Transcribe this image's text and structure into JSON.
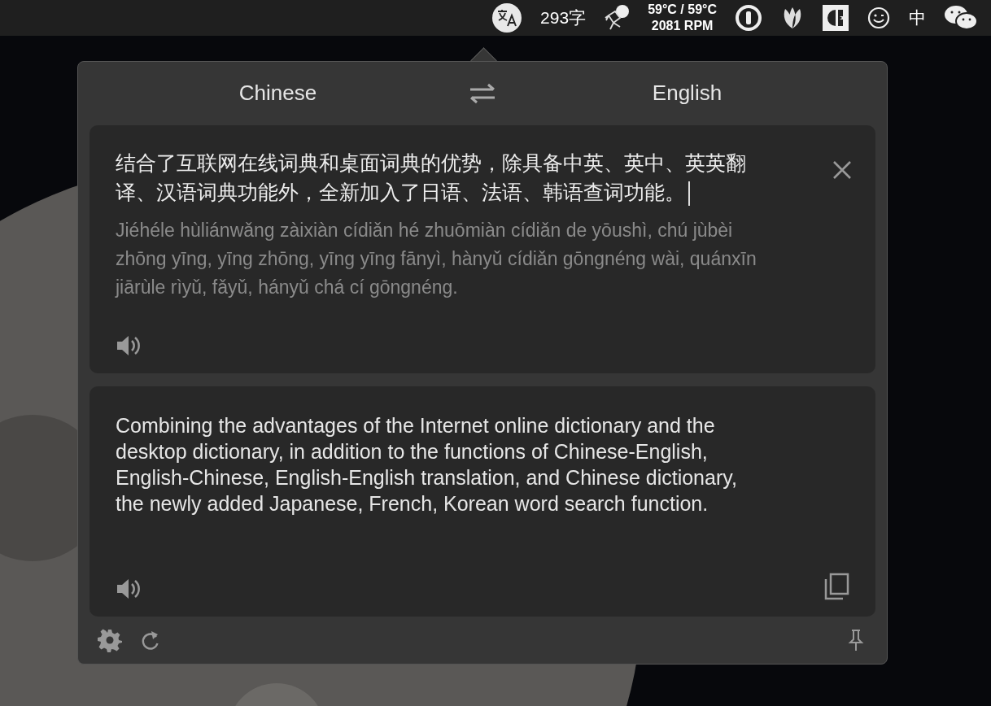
{
  "menu_bar": {
    "word_count": "293字",
    "temperature": "59°C / 59°C",
    "fan_speed": "2081 RPM",
    "input_method": "中"
  },
  "translator": {
    "source_language": "Chinese",
    "target_language": "English",
    "source_text": "结合了互联网在线词典和桌面词典的优势，除具备中英、英中、英英翻译、汉语词典功能外，全新加入了日语、法语、韩语查词功能。",
    "pinyin": "Jiéhéle hùliánwǎng zàixiàn cídiǎn hé zhuōmiàn cídiǎn de yōushì, chú jùbèi zhōng yīng, yīng zhōng, yīng yīng fānyì, hànyǔ cídiǎn gōngnéng wài, quánxīn jiārùle rìyǔ, fǎyǔ, hányǔ chá cí gōngnéng.",
    "translation": "Combining the advantages of the Internet online dictionary and the desktop dictionary, in addition to the functions of Chinese-English, English-Chinese, English-English translation, and Chinese dictionary, the newly added Japanese, French, Korean word search function."
  }
}
